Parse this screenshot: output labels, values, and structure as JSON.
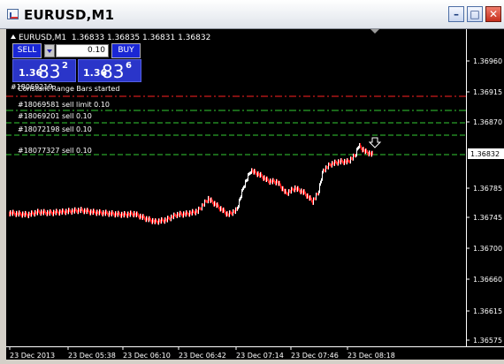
{
  "window": {
    "title": "EURUSD,M1"
  },
  "header": {
    "symbol_line": "EURUSD,M1",
    "ohlc": "1.36833 1.36835 1.36831 1.36832"
  },
  "trade_panel": {
    "sell_label": "SELL",
    "buy_label": "BUY",
    "lot_value": "0.10",
    "sell_quote": {
      "prefix": "1.36",
      "big": "83",
      "sup": "2"
    },
    "buy_quote": {
      "prefix": "1.36",
      "big": "83",
      "sup": "6"
    }
  },
  "chart_texts": {
    "overlap_text": "#18069219",
    "started_message": "Constant Range Bars started"
  },
  "orders": [
    {
      "label": "",
      "color": "#ff2020",
      "style": "dashdot"
    },
    {
      "label": "#18069581 sell limit 0.10",
      "color": "#33cc33",
      "style": "dashdot"
    },
    {
      "label": "#18069201 sell 0.10",
      "color": "#33cc33",
      "style": "dashed"
    },
    {
      "label": "#18072198 sell 0.10",
      "color": "#33cc33",
      "style": "dashed"
    },
    {
      "label": "#18077327 sell 0.10",
      "color": "#33cc33",
      "style": "dashed"
    }
  ],
  "price_axis": {
    "labels": [
      "1.36960",
      "1.36915",
      "1.36870",
      "1.36832",
      "1.36785",
      "1.36745",
      "1.36700",
      "1.36660",
      "1.36615",
      "1.36575"
    ],
    "current_price": "1.36832"
  },
  "time_axis": {
    "labels": [
      "23 Dec 2013",
      "23 Dec 05:38",
      "23 Dec 06:10",
      "23 Dec 06:42",
      "23 Dec 07:14",
      "23 Dec 07:46",
      "23 Dec 08:18"
    ]
  },
  "colors": {
    "bull": "#ffffff",
    "bear": "#ff2020",
    "panel_blue": "#1a27d4"
  }
}
